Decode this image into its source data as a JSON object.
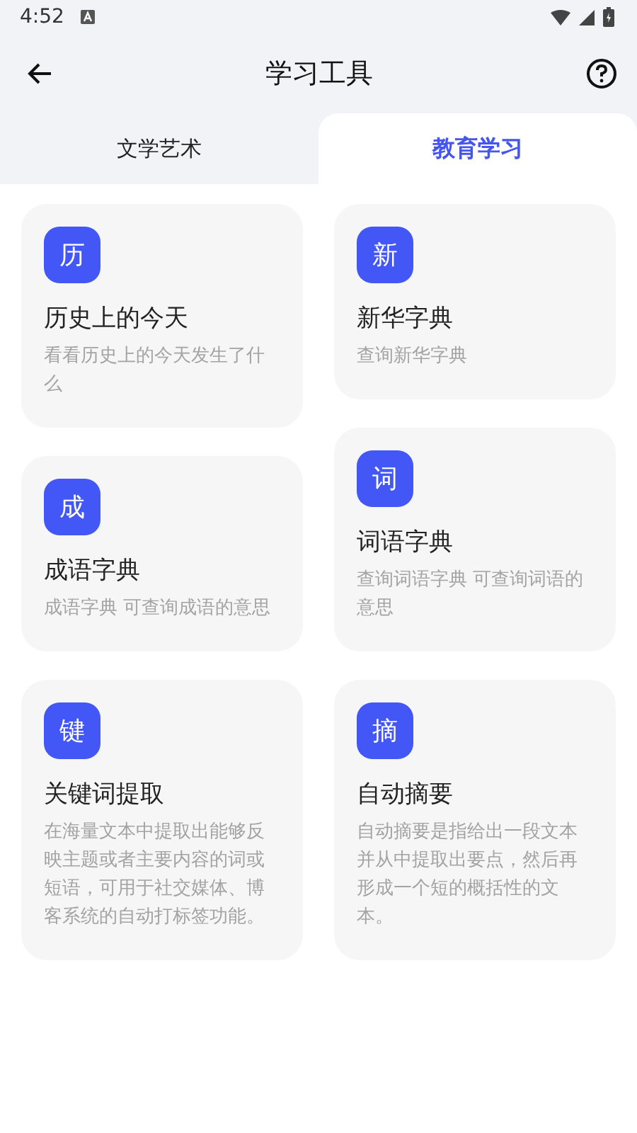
{
  "status_bar": {
    "time": "4:52"
  },
  "header": {
    "title": "学习工具"
  },
  "tabs": [
    {
      "label": "文学艺术",
      "selected": false
    },
    {
      "label": "教育学习",
      "selected": true
    }
  ],
  "columns": [
    [
      {
        "icon": "历",
        "title": "历史上的今天",
        "description": "看看历史上的今天发生了什么"
      },
      {
        "icon": "成",
        "title": "成语字典",
        "description": "成语字典 可查询成语的意思"
      },
      {
        "icon": "键",
        "title": "关键词提取",
        "description": "在海量文本中提取出能够反映主题或者主要内容的词或短语，可用于社交媒体、博客系统的自动打标签功能。"
      }
    ],
    [
      {
        "icon": "新",
        "title": "新华字典",
        "description": "查询新华字典"
      },
      {
        "icon": "词",
        "title": "词语字典",
        "description": "查询词语字典 可查询词语的意思"
      },
      {
        "icon": "摘",
        "title": "自动摘要",
        "description": "自动摘要是指给出一段文本并从中提取出要点，然后再形成一个短的概括性的文本。"
      }
    ]
  ]
}
